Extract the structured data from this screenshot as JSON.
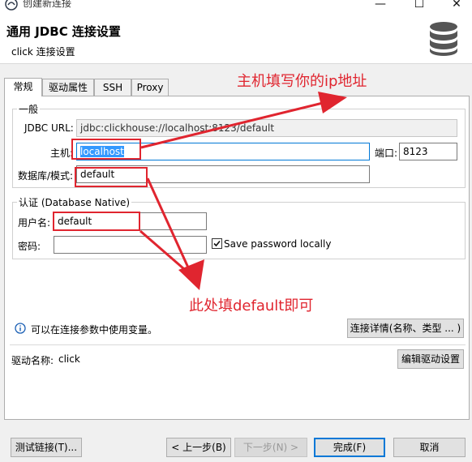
{
  "window": {
    "title": "创建新连接",
    "minimize": "—",
    "maximize": "☐",
    "close": "✕"
  },
  "header": {
    "title": "通用 JDBC 连接设置",
    "subtitle": "click 连接设置"
  },
  "tabs": [
    {
      "label": "常规",
      "active": true
    },
    {
      "label": "驱动属性",
      "active": false
    },
    {
      "label": "SSH",
      "active": false
    },
    {
      "label": "Proxy",
      "active": false
    }
  ],
  "general": {
    "group_title": "一般",
    "jdbc_url_label": "JDBC URL:",
    "jdbc_url_value": "jdbc:clickhouse://localhost:8123/default",
    "host_label": "主机:",
    "host_value": "localhost",
    "port_label": "端口:",
    "port_value": "8123",
    "database_label": "数据库/模式:",
    "database_value": "default"
  },
  "auth": {
    "group_title": "认证 (Database Native)",
    "user_label": "用户名:",
    "user_value": "default",
    "password_label": "密码:",
    "password_value": "",
    "save_password_label": "Save password locally",
    "save_password_checked": true
  },
  "info": {
    "text": "可以在连接参数中使用变量。",
    "details_button": "连接详情(名称、类型 ... )"
  },
  "driver": {
    "label": "驱动名称:",
    "value": "click",
    "edit_button": "编辑驱动设置"
  },
  "footer": {
    "test_button": "测试链接(T)...",
    "back_button": "< 上一步(B)",
    "next_button": "下一步(N) >",
    "finish_button": "完成(F)",
    "cancel_button": "取消"
  },
  "annotations": {
    "host_note": "主机填写你的ip地址",
    "default_note": "此处填default即可"
  },
  "colors": {
    "annotation_red": "#e0252f",
    "selection_blue": "#3399ff",
    "focus_blue": "#0078d7"
  }
}
